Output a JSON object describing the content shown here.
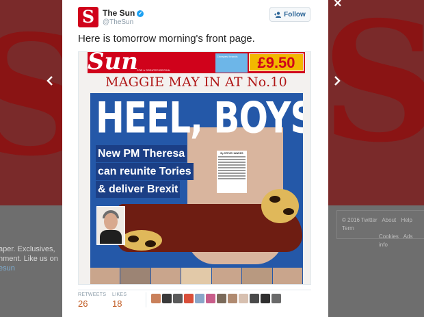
{
  "background": {
    "left_text_lines": [
      "aper. Exclusives,",
      "nment. Like us on"
    ],
    "left_handle": "esun",
    "right_links_row1": [
      "© 2016 Twitter",
      "About",
      "Help",
      "Term"
    ],
    "right_links_row2": [
      "Cookies",
      "Ads info"
    ]
  },
  "nav": {
    "prev_icon": "chevron-left-icon",
    "next_icon": "chevron-right-icon",
    "close_glyph": "×"
  },
  "tweet": {
    "account_name": "The Sun",
    "handle": "@TheSun",
    "avatar_letter": "S",
    "follow_label": "Follow",
    "text": "Here is tomorrow morning's front page.",
    "retweets_label": "RETWEETS",
    "retweets_count": "26",
    "likes_label": "LIKES",
    "likes_count": "18",
    "liker_colors": [
      "#c9805a",
      "#3a3a3a",
      "#5a5a5a",
      "#d94f3a",
      "#8aa6c8",
      "#c85d8a",
      "#7a6a5a",
      "#b08a70",
      "#d7c0b0",
      "#4a4a4a",
      "#2f2f2f",
      "#6a6a6a"
    ]
  },
  "front_page": {
    "masthead_title": "Sun",
    "masthead_tagline": "FOR A GREATER BRITAIN",
    "promo_text": "Cheapest brands",
    "price": "£9.50",
    "kicker": "MAGGIE MAY IN AT No.10",
    "headline": "HEEL, BOYS",
    "subhead": [
      "New PM Theresa",
      "can reunite Tories",
      "& deliver Brexit"
    ],
    "column_byline": "By STEVE HAWKES"
  },
  "colors": {
    "sun_red": "#d0021b",
    "cover_blue": "#2458a8",
    "follow_blue": "#2a6496",
    "stat_orange": "#c15a21"
  }
}
